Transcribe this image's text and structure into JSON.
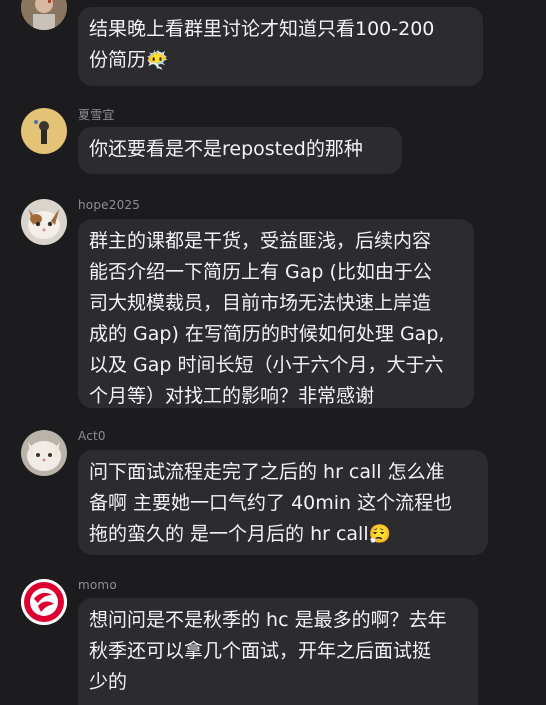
{
  "messages": [
    {
      "name": "",
      "lines": [
        "结果晚上看群里讨论才知道只看100-200",
        "份简历"
      ],
      "emoji": "😶‍🌫️"
    },
    {
      "name": "夏雪宜",
      "lines": [
        "你还要看是不是reposted的那种"
      ]
    },
    {
      "name": "hope2025",
      "lines": [
        "群主的课都是干货，受益匪浅，后续内容",
        "能否介绍一下简历上有 Gap (比如由于公",
        "司大规模裁员，目前市场无法快速上岸造",
        "成的 Gap) 在写简历的时候如何处理 Gap,",
        "以及 Gap 时间长短（小于六个月，大于六",
        "个月等）对找工的影响？非常感谢"
      ]
    },
    {
      "name": "Act0",
      "lines": [
        "问下面试流程走完了之后的 hr call 怎么准",
        "备啊 主要她一口气约了 40min 这个流程也",
        "拖的蛮久的 是一个月后的 hr call"
      ],
      "emoji": "😮‍💨"
    },
    {
      "name": "momo",
      "lines": [
        "想问问是不是秋季的 hc 是最多的啊？去年",
        "秋季还可以拿几个面试，开年之后面试挺",
        "少的"
      ]
    }
  ]
}
